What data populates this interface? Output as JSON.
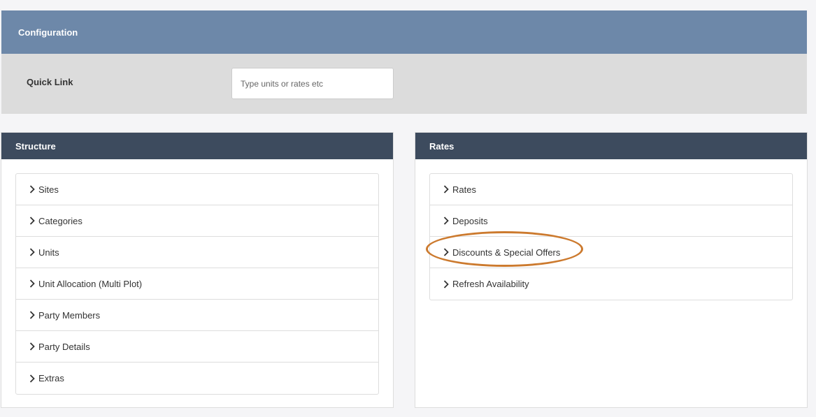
{
  "config": {
    "title": "Configuration",
    "quick_link_label": "Quick Link",
    "quick_link_placeholder": "Type units or rates etc",
    "quick_link_value": ""
  },
  "structure": {
    "title": "Structure",
    "items": [
      {
        "label": "Sites",
        "icon": "chevron-right-icon"
      },
      {
        "label": "Categories",
        "icon": "chevron-right-icon"
      },
      {
        "label": "Units",
        "icon": "chevron-right-icon"
      },
      {
        "label": "Unit Allocation (Multi Plot)",
        "icon": "chevron-right-icon"
      },
      {
        "label": "Party Members",
        "icon": "chevron-right-icon"
      },
      {
        "label": "Party Details",
        "icon": "chevron-right-icon"
      },
      {
        "label": "Extras",
        "icon": "chevron-right-icon"
      }
    ]
  },
  "rates": {
    "title": "Rates",
    "items": [
      {
        "label": "Rates",
        "icon": "chevron-right-icon"
      },
      {
        "label": "Deposits",
        "icon": "chevron-right-icon"
      },
      {
        "label": "Discounts & Special Offers",
        "icon": "chevron-right-icon",
        "highlighted": true
      },
      {
        "label": "Refresh Availability",
        "icon": "chevron-right-icon"
      }
    ]
  },
  "colors": {
    "config_header": "#6d88a9",
    "panel_header": "#3d4b5e",
    "highlight": "#cc7a2e"
  }
}
